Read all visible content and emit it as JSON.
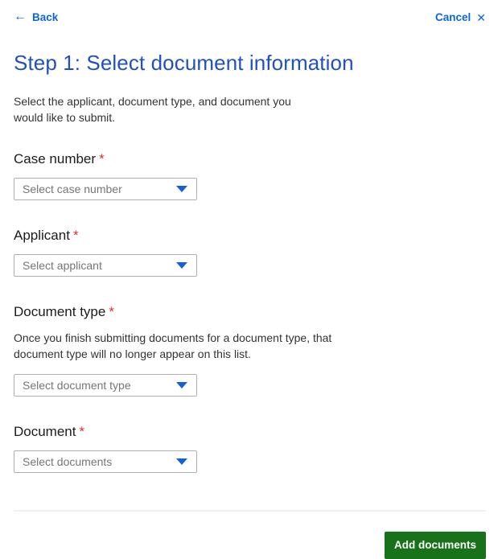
{
  "header": {
    "back_label": "Back",
    "cancel_label": "Cancel"
  },
  "icons": {
    "back_arrow": "←",
    "cancel_x": "✕"
  },
  "page": {
    "title": "Step 1: Select document information",
    "subtitle": "Select the applicant, document type, and document you would like to submit."
  },
  "form": {
    "fields": [
      {
        "label": "Case number",
        "required_marker": "*",
        "placeholder": "Select case number"
      },
      {
        "label": "Applicant",
        "required_marker": "*",
        "placeholder": "Select applicant"
      },
      {
        "label": "Document type",
        "required_marker": "*",
        "help": "Once you finish submitting documents for a document type, that document type will no longer appear on this list.",
        "placeholder": "Select document type"
      },
      {
        "label": "Document",
        "required_marker": "*",
        "placeholder": "Select documents"
      }
    ]
  },
  "footer": {
    "add_button_label": "Add documents"
  },
  "colors": {
    "link_blue": "#0b67d6",
    "title_blue": "#2150c4",
    "required_red": "#de2f2f",
    "button_green": "#17721a",
    "select_border_gray": "#b0b0b0",
    "placeholder_gray": "#767676",
    "caret_blue": "#1261d6",
    "divider_gray": "#f0f0f0"
  }
}
